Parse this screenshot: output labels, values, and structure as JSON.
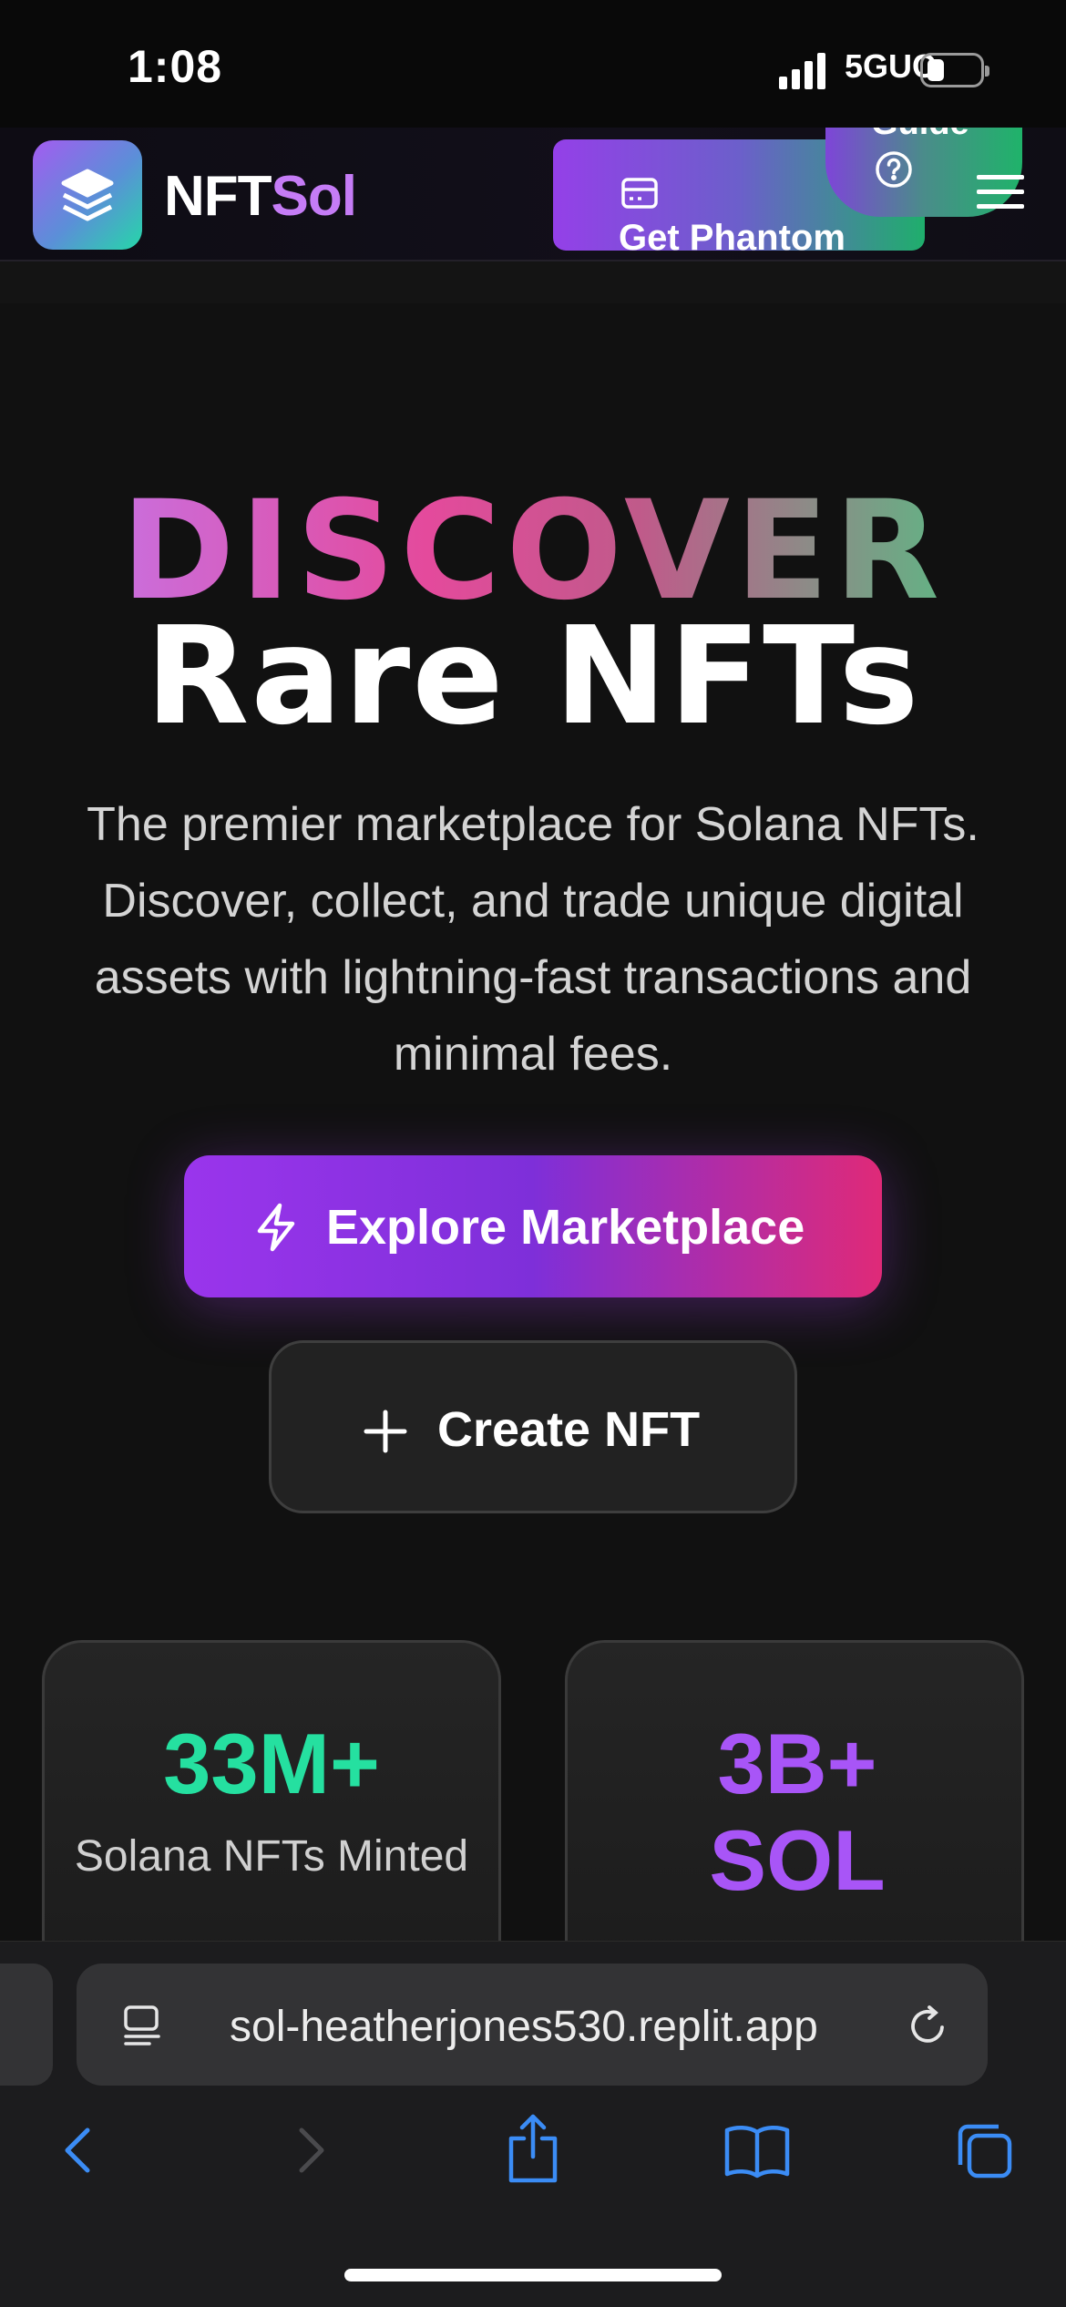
{
  "status_bar": {
    "time": "1:08",
    "network": "5GUC",
    "icons": [
      "signal-bars-icon",
      "battery-icon"
    ]
  },
  "header": {
    "brand_prefix": "NFT",
    "brand_suffix": "Sol",
    "phantom_button_label": "Get Phantom",
    "guide_label": "Guide",
    "icons": [
      "layers-logo-icon",
      "wallet-card-icon",
      "help-circle-icon",
      "hamburger-menu-icon"
    ]
  },
  "hero": {
    "headline_top": "DISCOVER",
    "headline_bottom": "Rare NFTs",
    "tagline": "The premier marketplace for Solana NFTs. Discover, collect, and trade unique digital assets with lightning-fast transactions and minimal fees.",
    "primary_button": "Explore Marketplace",
    "secondary_button": "Create NFT",
    "icons": [
      "lightning-icon",
      "plus-icon"
    ]
  },
  "stats": [
    {
      "value": "33M+",
      "label": "Solana NFTs Minted",
      "color": "#25e0a0"
    },
    {
      "value": "3B+ SOL",
      "label": "",
      "color": "#a855f7"
    }
  ],
  "browser": {
    "url": "sol-heatherjones530.replit.app",
    "icons": [
      "page-menu-icon",
      "reload-icon",
      "back-icon",
      "forward-icon",
      "share-icon",
      "bookmarks-icon",
      "tabs-icon"
    ]
  },
  "colors": {
    "accent_purple": "#9a35ec",
    "accent_pink": "#df2a78",
    "accent_green": "#25e0a0",
    "brand_sol": "#c57cf6",
    "ios_blue": "#3b8cf5"
  }
}
